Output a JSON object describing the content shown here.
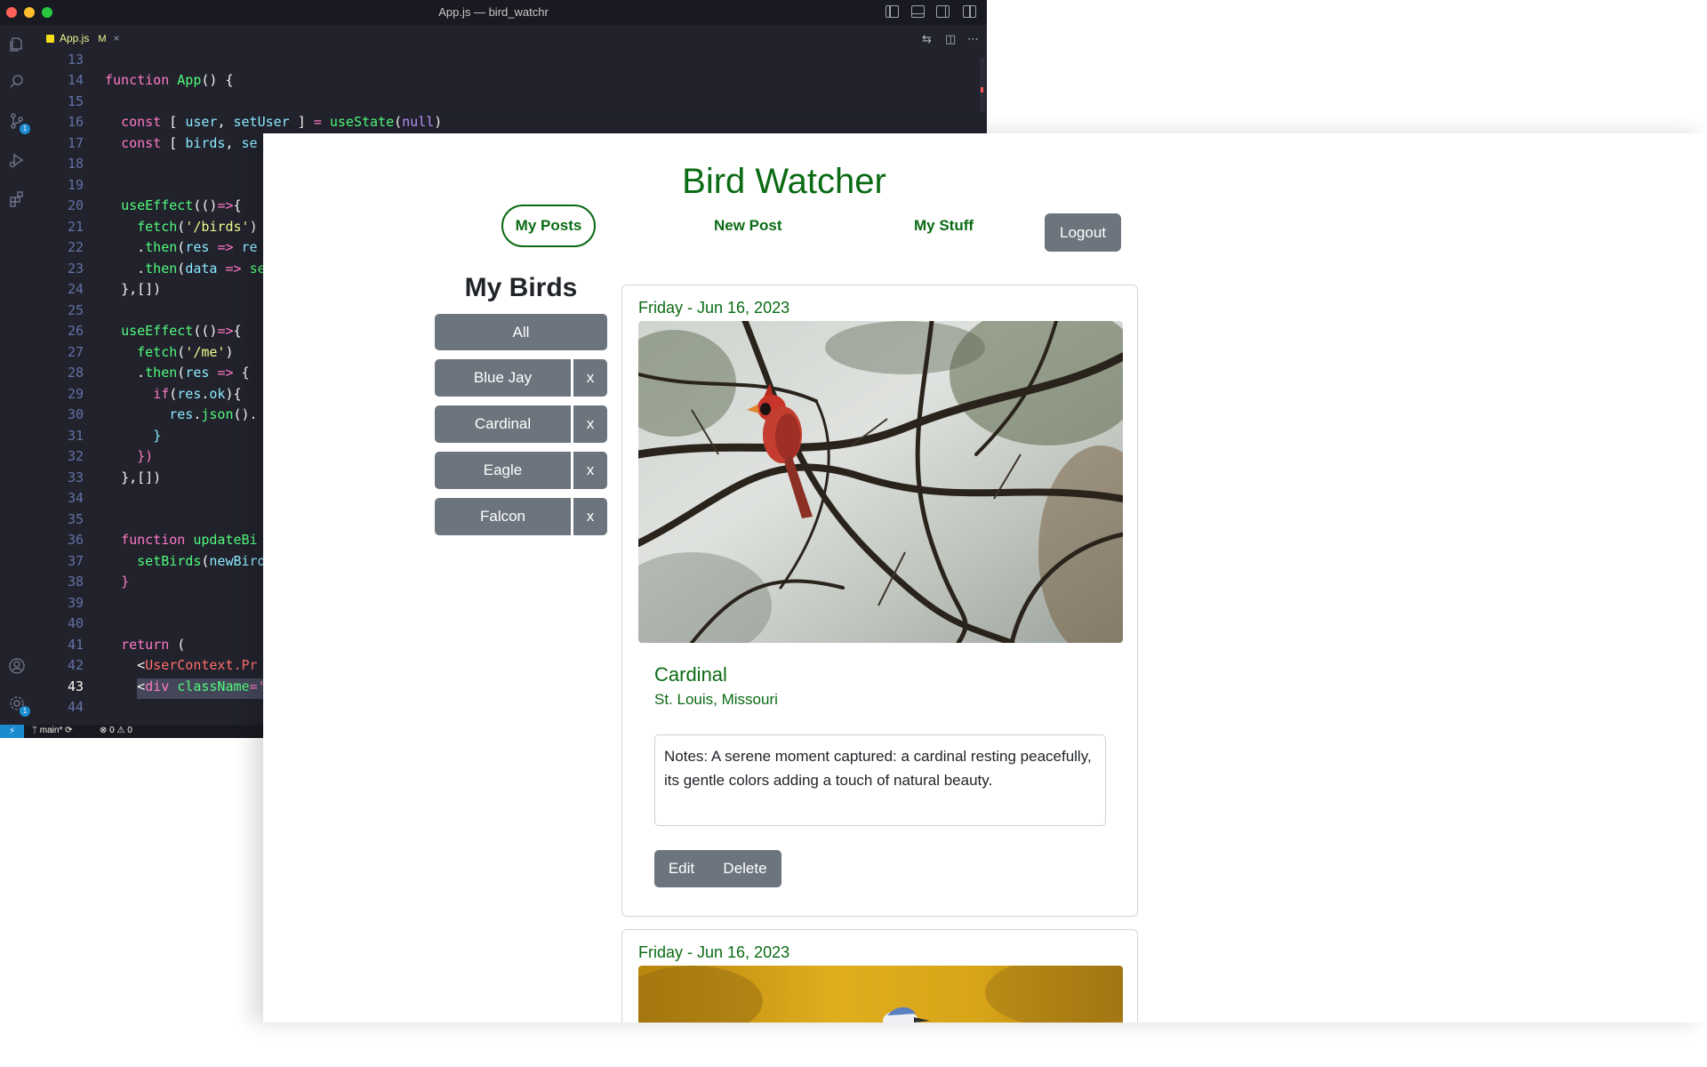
{
  "vscode": {
    "window_title": "App.js — bird_watchr",
    "tab": {
      "filename": "App.js",
      "modified_flag": "M",
      "close": "×"
    },
    "status": {
      "remote": "⚡",
      "branch": "main*",
      "sync": "⟳",
      "problems": "⊗ 0 ⚠ 0"
    },
    "activity_icons": [
      "explorer-icon",
      "search-icon",
      "source-control-icon",
      "run-debug-icon",
      "extensions-icon",
      "account-icon",
      "settings-gear-icon"
    ],
    "badges": {
      "source_control": "1",
      "settings": "1"
    },
    "code_lines": [
      {
        "n": "13",
        "code": ""
      },
      {
        "n": "14",
        "code": "function App() {"
      },
      {
        "n": "15",
        "code": ""
      },
      {
        "n": "16",
        "code": "const [ user, setUser ] = useState(null)"
      },
      {
        "n": "17",
        "code": "const [ birds, se"
      },
      {
        "n": "18",
        "code": ""
      },
      {
        "n": "19",
        "code": ""
      },
      {
        "n": "20",
        "code": "useEffect(()=>{"
      },
      {
        "n": "21",
        "code": "fetch('/birds')"
      },
      {
        "n": "22",
        "code": ".then(res => re"
      },
      {
        "n": "23",
        "code": ".then(data => se"
      },
      {
        "n": "24",
        "code": "},[])"
      },
      {
        "n": "25",
        "code": ""
      },
      {
        "n": "26",
        "code": "useEffect(()=>{"
      },
      {
        "n": "27",
        "code": "fetch('/me')"
      },
      {
        "n": "28",
        "code": ".then(res => {"
      },
      {
        "n": "29",
        "code": "if(res.ok){"
      },
      {
        "n": "30",
        "code": "res.json()."
      },
      {
        "n": "31",
        "code": "}"
      },
      {
        "n": "32",
        "code": "})"
      },
      {
        "n": "33",
        "code": "},[])"
      },
      {
        "n": "34",
        "code": ""
      },
      {
        "n": "35",
        "code": ""
      },
      {
        "n": "36",
        "code": "function updateBi"
      },
      {
        "n": "37",
        "code": "setBirds(newBird"
      },
      {
        "n": "38",
        "code": "}"
      },
      {
        "n": "39",
        "code": ""
      },
      {
        "n": "40",
        "code": ""
      },
      {
        "n": "41",
        "code": "return ("
      },
      {
        "n": "42",
        "code": "<UserContext.Pr"
      },
      {
        "n": "43",
        "code": "<div className='"
      },
      {
        "n": "44",
        "code": ""
      }
    ]
  },
  "app": {
    "title": "Bird Watcher",
    "nav": {
      "my_posts": "My Posts",
      "new_post": "New Post",
      "my_stuff": "My Stuff",
      "logout": "Logout"
    },
    "sidebar": {
      "title": "My Birds",
      "all_label": "All",
      "remove_label": "x",
      "birds": [
        "Blue Jay",
        "Cardinal",
        "Eagle",
        "Falcon"
      ]
    },
    "posts": [
      {
        "date": "Friday - Jun 16, 2023",
        "species": "Cardinal",
        "location": "St. Louis, Missouri",
        "notes": "Notes: A serene moment captured: a cardinal resting peacefully, its gentle colors adding a touch of natural beauty.",
        "edit_label": "Edit",
        "delete_label": "Delete"
      },
      {
        "date": "Friday - Jun 16, 2023"
      }
    ],
    "colors": {
      "brand_green": "#0a6b14",
      "button_gray": "#6c757d"
    }
  }
}
